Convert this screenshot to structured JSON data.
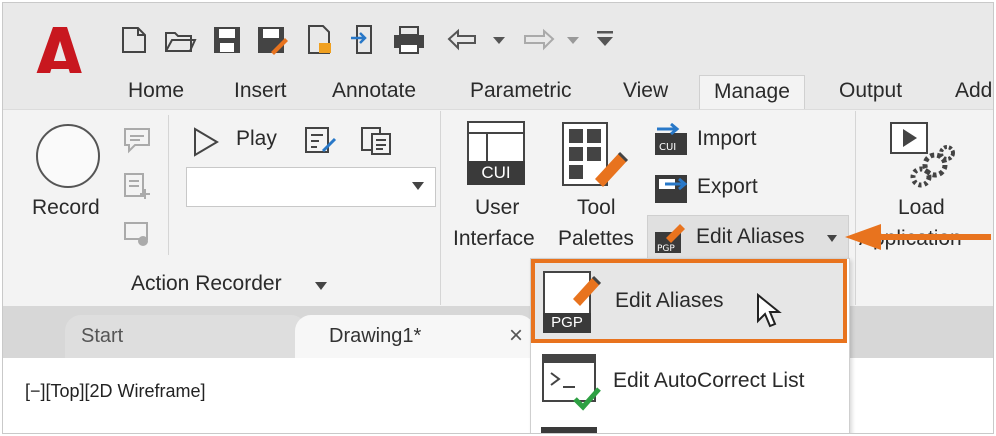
{
  "app": {
    "logo_letter": "A"
  },
  "quick_access": {
    "icons": [
      "new-icon",
      "open-icon",
      "save-icon",
      "save-as-icon",
      "open-from-web-icon",
      "export-icon",
      "plot-icon",
      "undo-icon",
      "redo-icon",
      "customize-dropdown-icon"
    ]
  },
  "tabs": [
    {
      "label": "Home"
    },
    {
      "label": "Insert"
    },
    {
      "label": "Annotate"
    },
    {
      "label": "Parametric"
    },
    {
      "label": "View"
    },
    {
      "label": "Manage",
      "active": true
    },
    {
      "label": "Output"
    },
    {
      "label": "Add"
    }
  ],
  "ribbon": {
    "record_label": "Record",
    "play_label": "Play",
    "panel_label": "Action Recorder",
    "user_interface_line1": "User",
    "user_interface_line2": "Interface",
    "cui_badge": "CUI",
    "tool_palettes_line1": "Tool",
    "tool_palettes_line2": "Palettes",
    "import_label": "Import",
    "export_label": "Export",
    "edit_aliases_label": "Edit Aliases",
    "load_line1": "Load",
    "load_line2": "Application"
  },
  "documents": {
    "start_tab": "Start",
    "drawing_tab": "Drawing1*",
    "close_glyph": "×"
  },
  "viewport": {
    "label": "[−][Top][2D Wireframe]"
  },
  "dropdown": {
    "items": [
      {
        "label": "Edit Aliases",
        "badge": "PGP",
        "highlighted": true
      },
      {
        "label": "Edit AutoCorrect List",
        "prompt": ">_"
      }
    ]
  },
  "colors": {
    "accent": "#e8731e",
    "logo": "#c8171f",
    "cui": "#3a3a3a"
  }
}
